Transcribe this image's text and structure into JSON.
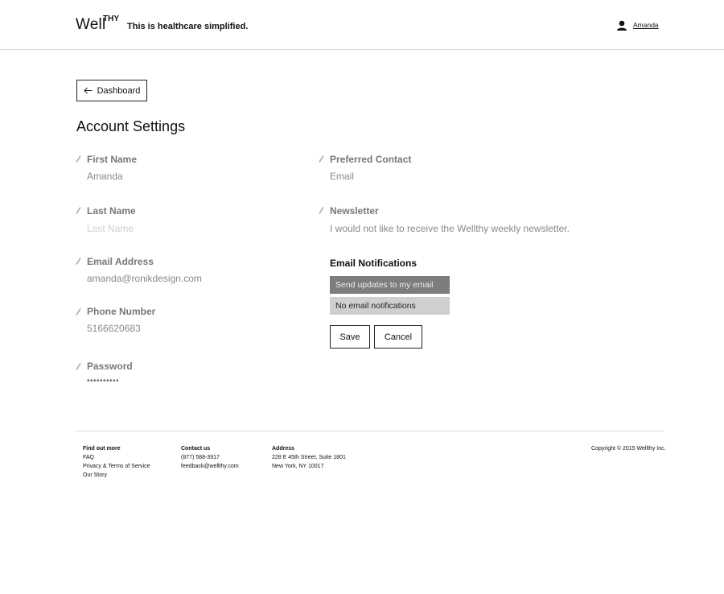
{
  "header": {
    "logo_text": "Well",
    "logo_sup": "THY",
    "tagline": "This is healthcare simplified.",
    "user_name": "Amanda"
  },
  "nav": {
    "back_label": "Dashboard"
  },
  "page_title": "Account Settings",
  "left_fields": [
    {
      "label": "First Name",
      "value": "Amanda"
    },
    {
      "label": "Last Name",
      "placeholder": "Last Name"
    },
    {
      "label": "Email Address",
      "value": "amanda@ronikdesign.com"
    },
    {
      "label": "Phone Number",
      "value": "5166620683"
    },
    {
      "label": "Password",
      "value": "••••••••••"
    }
  ],
  "right_fields": [
    {
      "label": "Preferred Contact",
      "value": "Email"
    },
    {
      "label": "Newsletter",
      "value": "I would not like to receive the Wellthy weekly newsletter."
    }
  ],
  "email_notifications": {
    "title": "Email Notifications",
    "options": [
      "Send updates to my email",
      "No email notifications"
    ],
    "selected": "Send updates to my email"
  },
  "actions": {
    "save": "Save",
    "cancel": "Cancel"
  },
  "footer": {
    "find_out_more": {
      "title": "Find out more",
      "links": [
        "FAQ",
        "Privacy & Terms of Service",
        "Our Story"
      ]
    },
    "contact": {
      "title": "Contact us",
      "phone": "(877) 588-3917",
      "email": "feedback@wellthy.com"
    },
    "address": {
      "title": "Address",
      "line1": "228 E 45th Street, Suite 1801",
      "line2": "New York, NY 10017"
    },
    "copyright": "Copyright © 2015 Wellthy Inc."
  },
  "colors": {
    "label_gray": "#777777",
    "value_gray": "#8a8a8a",
    "selected_option": "#7d7d7d",
    "unselected_option": "#cfcfcf"
  }
}
